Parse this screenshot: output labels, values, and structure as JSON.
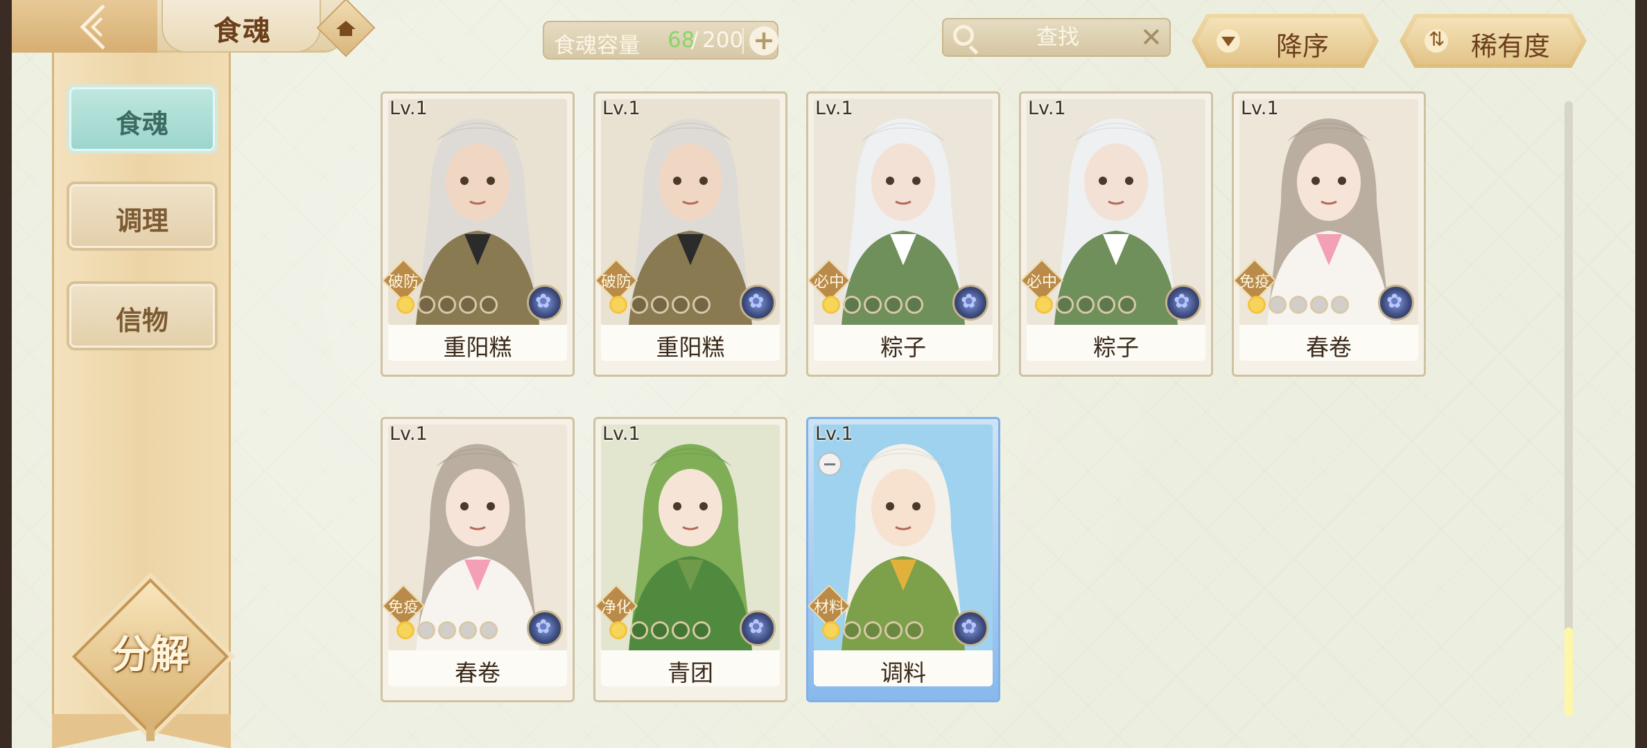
{
  "header": {
    "title": "食魂"
  },
  "capacity": {
    "label": "食魂容量",
    "current": "68",
    "separator": "/",
    "max": "200"
  },
  "search": {
    "placeholder": "查找"
  },
  "sort": {
    "order_label": "降序",
    "rarity_label": "稀有度"
  },
  "sidebar": {
    "items": [
      {
        "label": "食魂",
        "active": true
      },
      {
        "label": "调理",
        "active": false
      },
      {
        "label": "信物",
        "active": false
      }
    ],
    "decompose_label": "分解"
  },
  "cards": [
    {
      "level": "Lv.1",
      "name": "重阳糕",
      "tag": "破防",
      "stars_lit": 1,
      "stars_total": 5,
      "selected": false,
      "palette": {
        "bg": "#e9e2d2",
        "hair": "#dedbd6",
        "skin": "#f0d7c3",
        "cloth": "#8a7a52",
        "accent": "#2b2b2b"
      }
    },
    {
      "level": "Lv.1",
      "name": "重阳糕",
      "tag": "破防",
      "stars_lit": 1,
      "stars_total": 5,
      "selected": false,
      "palette": {
        "bg": "#e9e2d2",
        "hair": "#dedbd6",
        "skin": "#f0d7c3",
        "cloth": "#8a7a52",
        "accent": "#2b2b2b"
      }
    },
    {
      "level": "Lv.1",
      "name": "粽子",
      "tag": "必中",
      "stars_lit": 1,
      "stars_total": 5,
      "selected": false,
      "palette": {
        "bg": "#ebe6d9",
        "hair": "#eef0f2",
        "skin": "#f3e1d5",
        "cloth": "#6f8f5b",
        "accent": "#ffffff"
      }
    },
    {
      "level": "Lv.1",
      "name": "粽子",
      "tag": "必中",
      "stars_lit": 1,
      "stars_total": 5,
      "selected": false,
      "palette": {
        "bg": "#ebe6d9",
        "hair": "#eef0f2",
        "skin": "#f3e1d5",
        "cloth": "#6f8f5b",
        "accent": "#ffffff"
      }
    },
    {
      "level": "Lv.1",
      "name": "春卷",
      "tag": "免疫",
      "stars_lit": 1,
      "stars_total": 5,
      "selected": false,
      "palette": {
        "bg": "#ede6d9",
        "hair": "#b9aea0",
        "skin": "#f7e4d8",
        "cloth": "#f7f3ef",
        "accent": "#f3a0b4"
      }
    },
    {
      "level": "Lv.1",
      "name": "春卷",
      "tag": "免疫",
      "stars_lit": 1,
      "stars_total": 5,
      "selected": false,
      "palette": {
        "bg": "#ede6d9",
        "hair": "#b9aea0",
        "skin": "#f7e4d8",
        "cloth": "#f7f3ef",
        "accent": "#f3a0b4"
      }
    },
    {
      "level": "Lv.1",
      "name": "青团",
      "tag": "净化",
      "stars_lit": 1,
      "stars_total": 5,
      "selected": false,
      "palette": {
        "bg": "#e2e6cf",
        "hair": "#7fae57",
        "skin": "#f6e5d7",
        "cloth": "#4f8a3e",
        "accent": "#6e9a4a"
      }
    },
    {
      "level": "Lv.1",
      "name": "调料",
      "tag": "材料",
      "stars_lit": 1,
      "stars_total": 5,
      "selected": true,
      "palette": {
        "bg": "#9fd2ee",
        "hair": "#f4f1ea",
        "skin": "#f7e1cf",
        "cloth": "#7da04a",
        "accent": "#e0b23c"
      }
    }
  ],
  "colors": {
    "page_bg": "#eceedf",
    "accent_gold": "#d7ae72",
    "active_tab": "#9bd5cc",
    "capacity_highlight": "#8ad46c"
  }
}
